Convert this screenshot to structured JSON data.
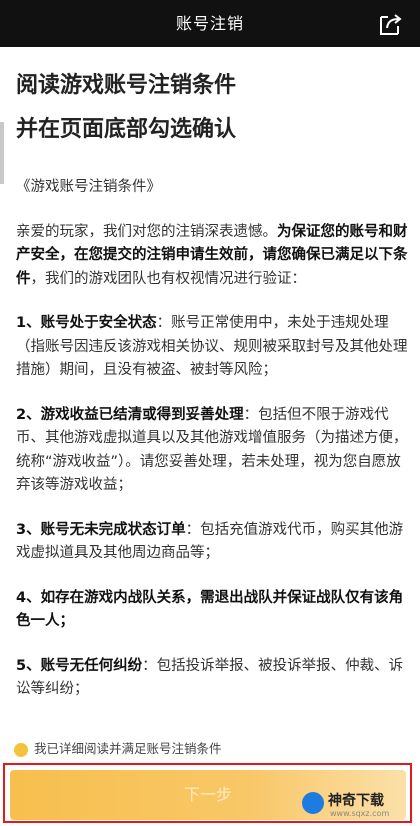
{
  "header": {
    "title": "账号注销",
    "share_icon": "share-icon"
  },
  "heading": {
    "line1": "阅读游戏账号注销条件",
    "line2": "并在页面底部勾选确认"
  },
  "content": {
    "doc_title": "《游戏账号注销条件》",
    "intro_plain1": "亲爱的玩家，我们对您的注销深表遗憾。",
    "intro_bold": "为保证您的账号和财产安全，在您提交的注销申请生效前，请您确保已满足以下条件",
    "intro_plain2": "，我们的游戏团队也有权视情况进行验证：",
    "c1_bold": "1、账号处于安全状态",
    "c1_text": "：账号正常使用中，未处于违规处理（指账号因违反该游戏相关协议、规则被采取封号及其他处理措施）期间，且没有被盗、被封等风险；",
    "c2_bold": "2、游戏收益已结清或得到妥善处理",
    "c2_text": "：包括但不限于游戏代币、其他游戏虚拟道具以及其他游戏增值服务（为描述方便，统称“游戏收益”）。请您妥善处理，若未处理，视为您自愿放弃该等游戏收益；",
    "c3_bold": "3、账号无未完成状态订单",
    "c3_text": "：包括充值游戏代币，购买其他游戏虚拟道具及其他周边商品等；",
    "c4_bold": "4、如存在游戏内战队关系，需退出战队并保证战队仅有该角色一人；",
    "c5_bold": "5、账号无任何纠纷",
    "c5_text": "：包括投诉举报、被投诉举报、仲裁、诉讼等纠纷；"
  },
  "footer": {
    "agree_label": "我已详细阅读并满足账号注销条件",
    "confirm_label": "下一步"
  },
  "watermark": {
    "text": "神奇下载",
    "url": "www.sqxz.com"
  },
  "colors": {
    "topbar": "#111111",
    "accent": "#f7bf4d",
    "highlight_frame": "#e11b1b"
  }
}
